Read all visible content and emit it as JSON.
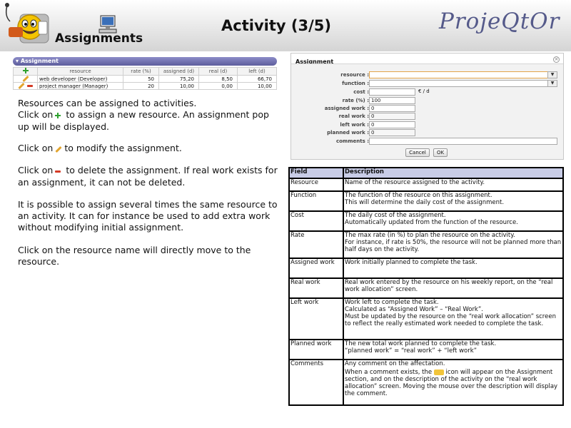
{
  "header": {
    "section": "Assignments",
    "title": "Activity (3/5)",
    "brand": "ProjeQtOr"
  },
  "mini_panel": {
    "title": "Assignment",
    "columns": [
      "resource",
      "rate (%)",
      "assigned (d)",
      "real (d)",
      "left (d)"
    ],
    "rows": [
      {
        "resource": "web developer (Developer)",
        "rate": "50",
        "assigned": "75,20",
        "real": "8,50",
        "left": "66,70"
      },
      {
        "resource": "project manager (Manager)",
        "rate": "20",
        "assigned": "10,00",
        "real": "0,00",
        "left": "10,00"
      }
    ]
  },
  "text": {
    "p1_line1": "Resources can be assigned to activities.",
    "p1_a": "Click on",
    "p1_b": "to assign a new resource. An assignment pop up will be displayed.",
    "p2_a": "Click on",
    "p2_b": "to modify the assignment.",
    "p3_a": "Click on",
    "p3_b": "to delete the assignment. If real work exists for an assignment, it can not be deleted.",
    "p4": "It is possible to assign several times the same resource to an activity. It can for instance be used to add extra work without modifying initial assignment.",
    "p5": "Click on the resource name will directly move to the resource."
  },
  "dialog": {
    "title": "Assignment",
    "close": "×",
    "fields": [
      {
        "label": "resource :",
        "value": ""
      },
      {
        "label": "function :",
        "value": ""
      },
      {
        "label": "cost :",
        "value": ""
      },
      {
        "label": "rate (%) :",
        "value": "100"
      },
      {
        "label": "assigned work :",
        "value": "0"
      },
      {
        "label": "real work :",
        "value": "0"
      },
      {
        "label": "left work :",
        "value": "0"
      },
      {
        "label": "planned work :",
        "value": "0"
      },
      {
        "label": "comments :",
        "value": ""
      }
    ],
    "cost_unit": "€ / d",
    "dropdown_arrow": "▼",
    "cancel": "Cancel",
    "ok": "OK"
  },
  "desc_table": {
    "headers": [
      "Field",
      "Description"
    ],
    "rows": [
      {
        "field": "Resource",
        "lines": [
          "Name of the resource assigned to the activity."
        ]
      },
      {
        "field": "Function",
        "lines": [
          "The function of the resource on this assignment.",
          "This will determine the daily cost of the assignment."
        ]
      },
      {
        "field": "Cost",
        "lines": [
          "The daily cost of the assignment.",
          "Automatically updated from the function of the resource."
        ]
      },
      {
        "field": "Rate",
        "lines": [
          "The max rate (in %) to plan the resource on the activity.",
          "For instance, if rate is 50%, the resource will not be planned more than half days on the activity."
        ]
      },
      {
        "field": "Assigned work",
        "lines": [
          "Work initially planned to complete the task."
        ]
      },
      {
        "field": "Real work",
        "lines": [
          "Real work entered by the resource on his weekly report, on the “real work allocation” screen."
        ]
      },
      {
        "field": "Left work",
        "lines": [
          "Work left to complete the task.",
          "Calculated as “Assigned Work” – “Real Work”.",
          "Must be updated by the resource on the “real work allocation” screen to reflect the really estimated work needed to complete the task."
        ]
      },
      {
        "field": "Planned work",
        "lines": [
          "The new total work planned to complete the task.",
          "“planned work” = “real work” + “left work”"
        ]
      },
      {
        "field": "Comments",
        "lines": [
          "Any comment on the affectation."
        ],
        "extra_a": "When a comment exists, the",
        "extra_b": "icon will appear on the Assignment section, and on the description of the activity on the “real work allocation” screen. Moving the mouse over the description will display the comment."
      }
    ]
  }
}
